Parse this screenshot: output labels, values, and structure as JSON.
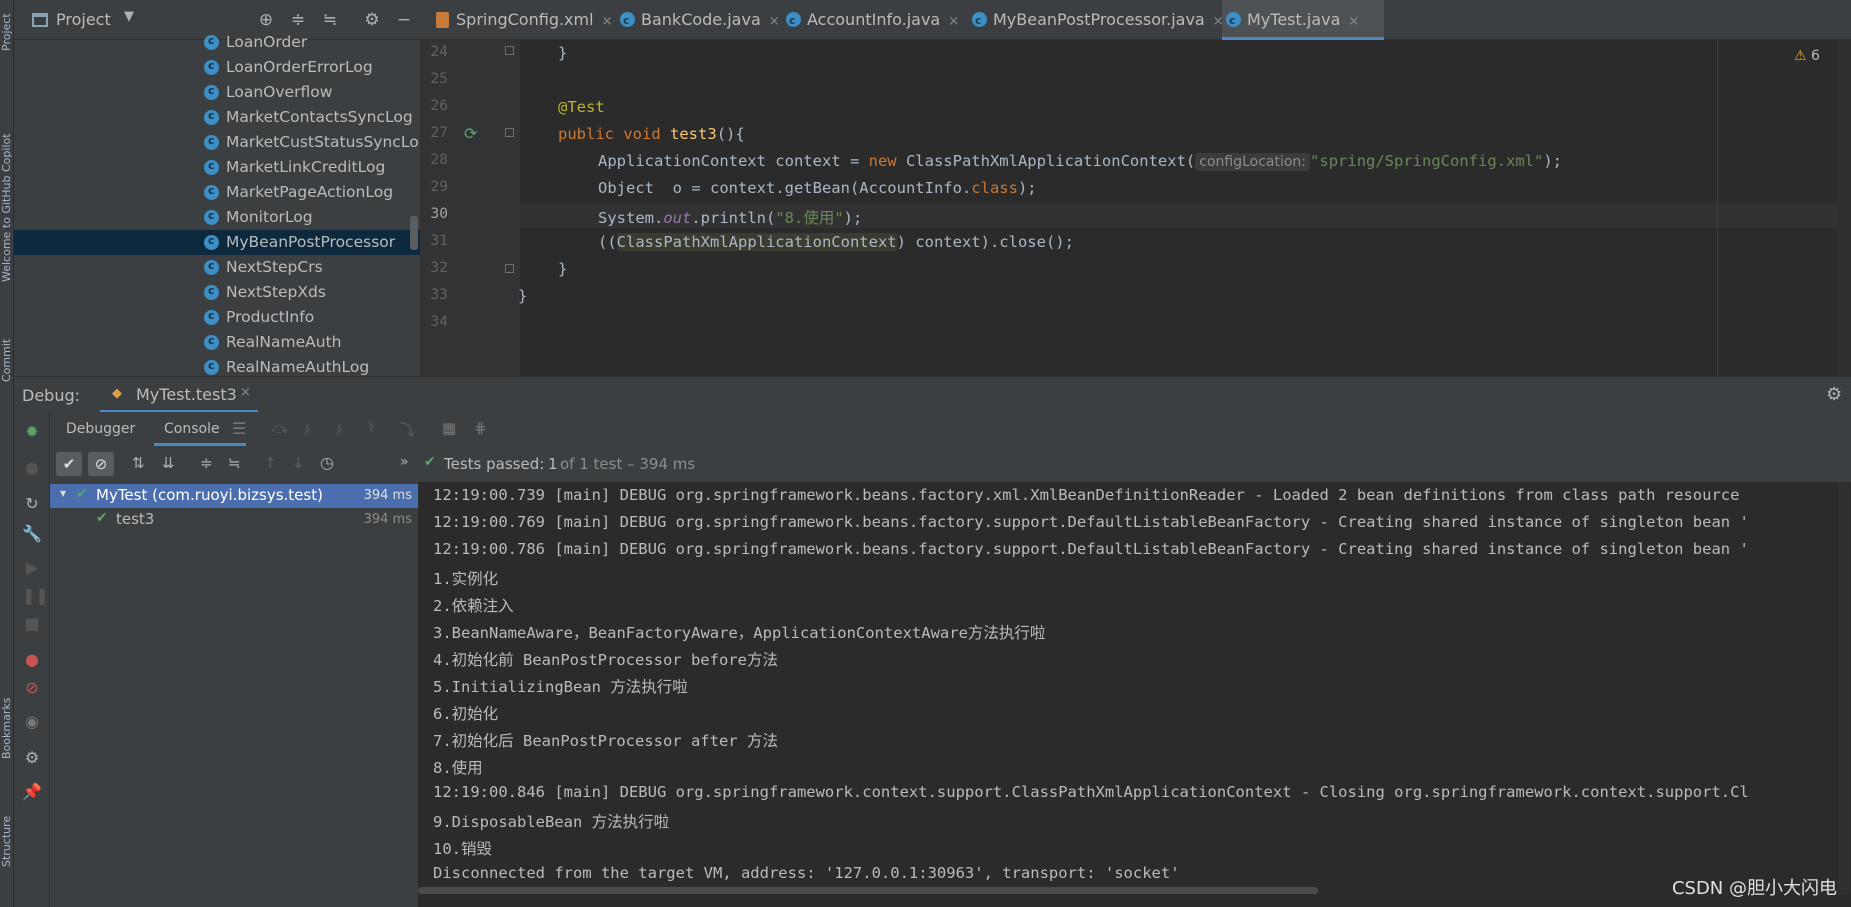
{
  "left_strip": {
    "labels": [
      "Project",
      "Welcome to GitHub Copilot",
      "Commit",
      "Bookmarks",
      "Structure"
    ]
  },
  "toolbar": {
    "project_label": "Project",
    "tabs": [
      {
        "label": "SpringConfig.xml",
        "icon": "xml-file-icon"
      },
      {
        "label": "BankCode.java",
        "icon": "class-icon"
      },
      {
        "label": "AccountInfo.java",
        "icon": "class-icon"
      },
      {
        "label": "MyBeanPostProcessor.java",
        "icon": "class-icon"
      },
      {
        "label": "MyTest.java",
        "icon": "test-class-icon",
        "active": true
      }
    ],
    "close_glyph": "×"
  },
  "project_tree": {
    "items": [
      "LoanOrder",
      "LoanOrderErrorLog",
      "LoanOverflow",
      "MarketContactsSyncLog",
      "MarketCustStatusSyncLo",
      "MarketLinkCreditLog",
      "MarketPageActionLog",
      "MonitorLog",
      "MyBeanPostProcessor",
      "NextStepCrs",
      "NextStepXds",
      "ProductInfo",
      "RealNameAuth",
      "RealNameAuthLog"
    ],
    "selected": "MyBeanPostProcessor"
  },
  "editor": {
    "warnings": "6",
    "line_numbers": [
      "24",
      "25",
      "26",
      "27",
      "28",
      "29",
      "30",
      "31",
      "32",
      "33",
      "34"
    ],
    "lines": {
      "l24": "}",
      "l26_ann": "@Test",
      "l27_kw1": "public",
      "l27_kw2": "void",
      "l27_fn": "test3",
      "l27_rest": "(){",
      "l28_a": "ApplicationContext context = ",
      "l28_kw": "new",
      "l28_b": " ClassPathXmlApplicationContext(",
      "l28_hint": "configLocation:",
      "l28_str": "\"spring/SpringConfig.xml\"",
      "l28_c": ");",
      "l29_a": "Object  o = context.getBean(AccountInfo.",
      "l29_kw": "class",
      "l29_b": ");",
      "l30_a": "System.",
      "l30_st": "out",
      "l30_b": ".println(",
      "l30_str": "\"8.使用\"",
      "l30_c": ");",
      "l31_a": "((",
      "l31_hl": "ClassPathXmlApplicationContext",
      "l31_b": ") context).close();",
      "l32": "}",
      "l33": "}"
    }
  },
  "debug": {
    "label": "Debug:",
    "session": "MyTest.test3",
    "tabs": [
      "Debugger",
      "Console"
    ],
    "active_tab": "Console",
    "status_prefix": "Tests passed:",
    "status_count": "1",
    "status_suffix": "of 1 test – 394 ms",
    "tests": [
      {
        "name": "MyTest (com.ruoyi.bizsys.test)",
        "time": "394 ms"
      },
      {
        "name": "test3",
        "time": "394 ms"
      }
    ]
  },
  "console": {
    "lines": [
      "12:19:00.739 [main] DEBUG org.springframework.beans.factory.xml.XmlBeanDefinitionReader - Loaded 2 bean definitions from class path resource",
      "12:19:00.769 [main] DEBUG org.springframework.beans.factory.support.DefaultListableBeanFactory - Creating shared instance of singleton bean '",
      "12:19:00.786 [main] DEBUG org.springframework.beans.factory.support.DefaultListableBeanFactory - Creating shared instance of singleton bean '",
      "1.实例化",
      "2.依赖注入",
      "3.BeanNameAware，BeanFactoryAware，ApplicationContextAware方法执行啦",
      "4.初始化前 BeanPostProcessor before方法",
      "5.InitializingBean 方法执行啦",
      "6.初始化",
      "7.初始化后 BeanPostProcessor after 方法",
      "8.使用",
      "12:19:00.846 [main] DEBUG org.springframework.context.support.ClassPathXmlApplicationContext - Closing org.springframework.context.support.Cl",
      "9.DisposableBean 方法执行啦",
      "10.销毁",
      "Disconnected from the target VM, address: '127.0.0.1:30963', transport: 'socket'"
    ]
  },
  "watermark": "CSDN @胆小大闪电",
  "colors": {
    "accent": "#4a88c7",
    "selection": "#0d293e",
    "test_selected": "#4b6eaf",
    "pass": "#59a869"
  }
}
